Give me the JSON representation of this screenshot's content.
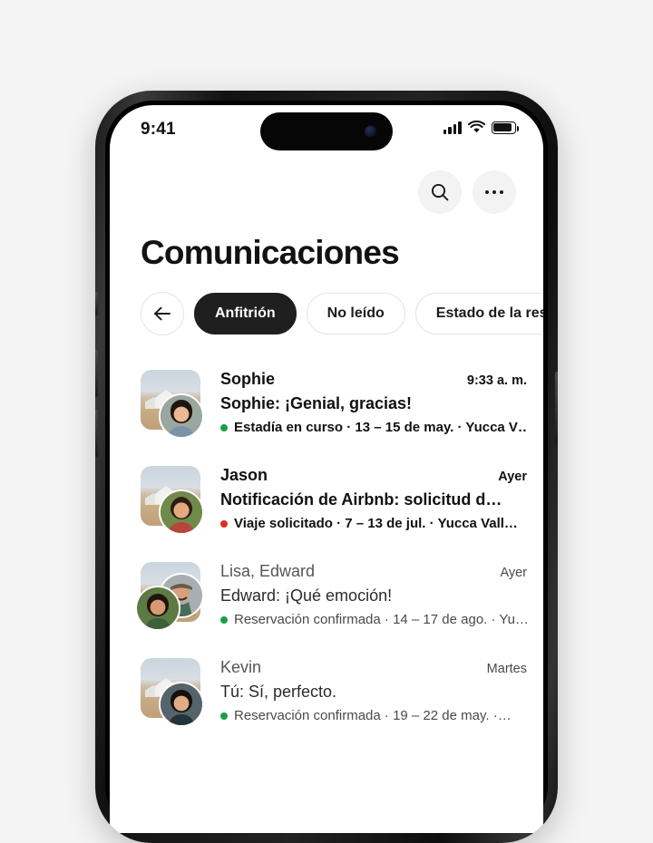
{
  "statusbar": {
    "time": "9:41",
    "signal_icon": "cellular-signal-icon",
    "wifi_icon": "wifi-icon",
    "battery_icon": "battery-icon"
  },
  "header": {
    "title": "Comunicaciones",
    "search_icon": "search-icon",
    "more_icon": "more-options-icon"
  },
  "filters": {
    "back_icon": "back-arrow-icon",
    "chips": [
      {
        "label": "Anfitrión",
        "active": true
      },
      {
        "label": "No leído",
        "active": false
      },
      {
        "label": "Estado de la reservación",
        "active": false
      }
    ]
  },
  "colors": {
    "status_green": "#1f9c4b",
    "status_red": "#dc2f20",
    "accent_dark": "#1f1f1f",
    "page_background": "#f4f4f4"
  },
  "conversations": [
    {
      "name": "Sophie",
      "time": "9:33 a. m.",
      "preview": "Sophie: ¡Genial, gracias!",
      "status_text": "Estadía en curso · 13 – 15 de may. · Yucca V…",
      "status_color": "#1f9c4b",
      "unread": true,
      "avatars": 1
    },
    {
      "name": "Jason",
      "time": "Ayer",
      "preview": "Notificación de Airbnb: solicitud d…",
      "status_text": "Viaje solicitado · 7 – 13 de jul. · Yucca Vall…",
      "status_color": "#dc2f20",
      "unread": true,
      "avatars": 1
    },
    {
      "name": "Lisa, Edward",
      "time": "Ayer",
      "preview": "Edward: ¡Qué emoción!",
      "status_text": "Reservación confirmada · 14 – 17 de ago. · Yu…",
      "status_color": "#1f9c4b",
      "unread": false,
      "avatars": 2
    },
    {
      "name": "Kevin",
      "time": "Martes",
      "preview": "Tú: Sí, perfecto.",
      "status_text": "Reservación confirmada · 19 – 22 de may. ·…",
      "status_color": "#1f9c4b",
      "unread": false,
      "avatars": 1
    }
  ]
}
